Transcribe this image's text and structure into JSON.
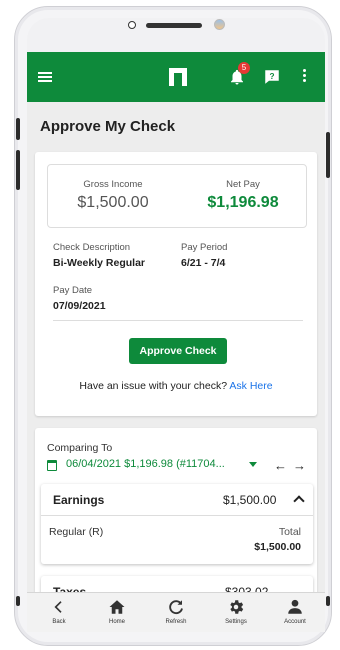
{
  "appbar": {
    "notification_count": "5",
    "accent_color": "#0e8a3b"
  },
  "page": {
    "title": "Approve My Check"
  },
  "check": {
    "gross_income_label": "Gross Income",
    "gross_income_value": "$1,500.00",
    "net_pay_label": "Net Pay",
    "net_pay_value": "$1,196.98",
    "description_label": "Check Description",
    "description_value": "Bi-Weekly Regular",
    "period_label": "Pay Period",
    "period_value": "6/21 - 7/4",
    "pay_date_label": "Pay Date",
    "pay_date_value": "07/09/2021",
    "approve_button": "Approve Check",
    "issue_text": "Have an issue with your check?",
    "issue_link": "Ask Here"
  },
  "comparing": {
    "label": "Comparing To",
    "selected": "06/04/2021 $1,196.98 (#11704...",
    "earnings": {
      "title": "Earnings",
      "total": "$1,500.00",
      "row_label": "Regular (R)",
      "column_label": "Total",
      "row_value": "$1,500.00"
    },
    "taxes": {
      "title": "Taxes",
      "total": "$303.02"
    }
  },
  "bottom_nav": {
    "items": [
      {
        "label": "Back",
        "icon": "chevron-left-icon"
      },
      {
        "label": "Home",
        "icon": "home-icon"
      },
      {
        "label": "Refresh",
        "icon": "refresh-icon"
      },
      {
        "label": "Settings",
        "icon": "gear-icon"
      },
      {
        "label": "Account",
        "icon": "person-icon"
      }
    ]
  }
}
